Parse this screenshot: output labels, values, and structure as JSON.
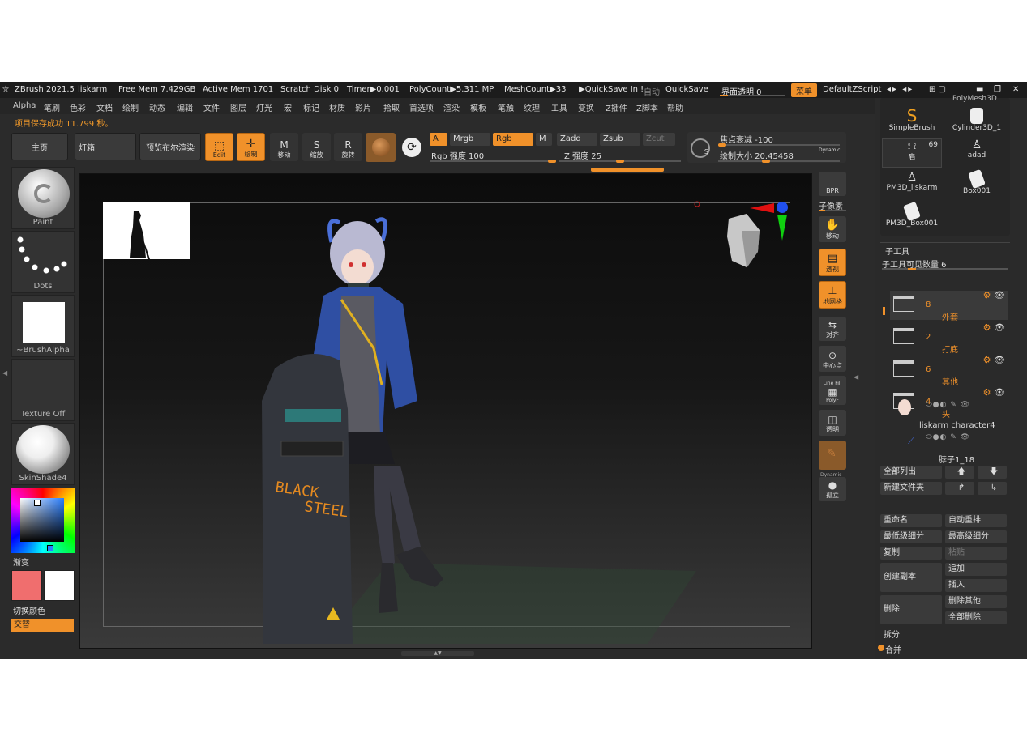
{
  "titlebar": {
    "app": "ZBrush 2021.5",
    "project": "liskarm",
    "free_mem": "Free Mem 7.429GB",
    "active_mem": "Active Mem 1701",
    "scratch": "Scratch Disk 0",
    "timer": "Timer▶0.001",
    "polycount": "PolyCount▶5.311 MP",
    "meshcount": "MeshCount▶33",
    "quicksave_in": "▶QuickSave In !",
    "auto": "自动",
    "quicksave": "QuickSave",
    "transparency": "界面透明 0",
    "menu": "菜单",
    "script": "DefaultZScript"
  },
  "menu": [
    "Alpha",
    "笔刷",
    "色彩",
    "文档",
    "绘制",
    "动态",
    "编辑",
    "文件",
    "图层",
    "灯光",
    "宏",
    "标记",
    "材质",
    "影片",
    "拾取",
    "首选项",
    "渲染",
    "模板",
    "笔触",
    "纹理",
    "工具",
    "变换",
    "Z插件",
    "Z脚本",
    "帮助"
  ],
  "status": "项目保存成功 11.799 秒。",
  "toolbar": {
    "home": "主页",
    "lightbox": "灯箱",
    "bpr_preview": "预览布尔渲染",
    "edit": "Edit",
    "draw": "绘制",
    "move": "移动",
    "scale": "缩放",
    "rotate": "旋转",
    "a": "A",
    "mrgb": "Mrgb",
    "rgb": "Rgb",
    "m": "M",
    "rgb_intensity": "Rgb 强度 100",
    "zadd": "Zadd",
    "zsub": "Zsub",
    "zcut": "Zcut",
    "z_intensity": "Z 强度 25",
    "focal_shift": "焦点衰减 -100",
    "draw_size": "绘制大小 20.45458",
    "dynamic": "Dynamic",
    "s_label": "S"
  },
  "left": {
    "paint": "Paint",
    "dots": "Dots",
    "alpha": "~BrushAlpha",
    "texture": "Texture Off",
    "material": "SkinShade4",
    "gradient": "渐变",
    "swap": "切换颜色",
    "alternate": "交替",
    "main_color": "#f06e6e",
    "sec_color": "#ffffff"
  },
  "viewport": {
    "shield_text1": "BLACK",
    "shield_text2": "STEEL"
  },
  "rightbar": {
    "bpr": "BPR",
    "subpixel": "子像素",
    "pan": "移动",
    "persp": "透视",
    "floor": "地网格",
    "frame": "对齐",
    "center": "中心点",
    "linefill": "Line Fill",
    "polyf": "PolyF",
    "transp": "透明",
    "dynamic": "Dynamic",
    "solo": "孤立"
  },
  "tools": {
    "top_label": "PolyMesh3D",
    "simple": "SimpleBrush",
    "cylinder": "Cylinder3D_1",
    "count": "69",
    "tool3": "肩",
    "tool4": "adad",
    "tool5": "PM3D_liskarm",
    "tool6": "Box001",
    "tool7": "PM3D_Box001"
  },
  "subtool": {
    "header": "子工具",
    "visible": "子工具可见数量 6",
    "folders": [
      {
        "count": "8",
        "name": "外套"
      },
      {
        "count": "2",
        "name": "打底"
      },
      {
        "count": "6",
        "name": "其他"
      },
      {
        "count": "4",
        "name": "头"
      }
    ],
    "items": [
      {
        "name": "liskarm character4"
      },
      {
        "name": "脖子1_18"
      }
    ],
    "list_all": "全部列出",
    "new_folder": "新建文件夹",
    "rename": "重命名",
    "autosort": "自动重排",
    "lowest": "最低级细分",
    "highest": "最高级细分",
    "copy": "复制",
    "paste": "粘贴",
    "duplicate": "创建副本",
    "append": "追加",
    "insert": "插入",
    "delete": "删除",
    "del_other": "删除其他",
    "del_all": "全部删除",
    "split": "拆分",
    "merge": "合并"
  }
}
